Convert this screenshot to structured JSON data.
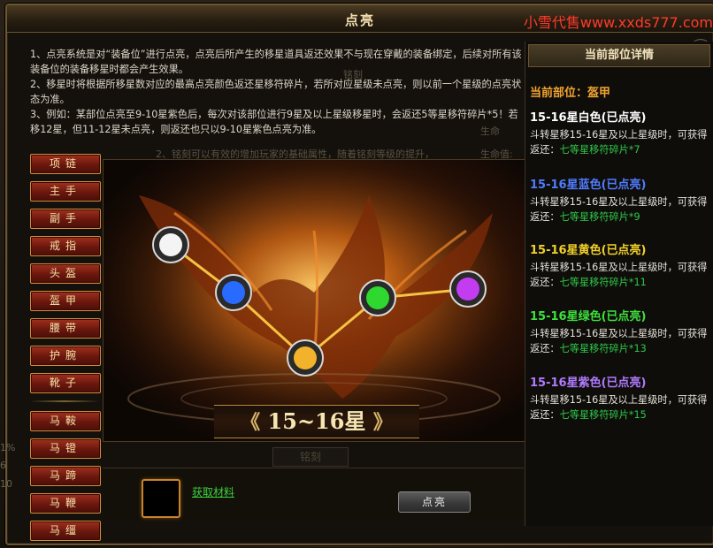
{
  "window": {
    "title": "点亮",
    "watermark": "小雪代售www.xxds777.com",
    "close": "✕"
  },
  "notes": [
    "1、点亮系统是对“装备位”进行点亮，点亮后所产生的移星道具返还效果不与现在穿戴的装备绑定，后续对所有该装备位的装备移星时都会产生效果。",
    "2、移星时将根据所移星数对应的最高点亮颜色返还星移符碎片，若所对应星级未点亮，则以前一个星级的点亮状态为准。",
    "3、例如：某部位点亮至9-10星紫色后，每次对该部位进行9星及以上星级移星时，会返还5等星移符碎片*5！若移12星，但11-12星未点亮，则返还也只以9-10星紫色点亮为准。"
  ],
  "ghosts": {
    "tab_top": "铭刻",
    "hint": "2、铭刻可以有效的增加玩家的基础属性，随着铭刻等级的提升，",
    "life": "生命值:",
    "gen": "生命",
    "tab_bottom": "铭刻"
  },
  "slots": [
    "项链",
    "主手",
    "副手",
    "戒指",
    "头盔",
    "盔甲",
    "腰带",
    "护腕",
    "靴子"
  ],
  "mount_slots": [
    "马鞍",
    "马镫",
    "马蹄",
    "马鞭",
    "马缰"
  ],
  "banner": {
    "text": "15~16星",
    "left": "《",
    "right": "》"
  },
  "orbs": [
    {
      "name": "white",
      "color": "#f4f4f4"
    },
    {
      "name": "blue",
      "color": "#2a6bff"
    },
    {
      "name": "yellow",
      "color": "#f2b22b"
    },
    {
      "name": "green",
      "color": "#2fd82f"
    },
    {
      "name": "purple",
      "color": "#c43cf0"
    }
  ],
  "materials": {
    "link": "获取材料"
  },
  "action": {
    "label": "点亮"
  },
  "right_panel": {
    "header": "当前部位详情",
    "current": "当前部位：盔甲",
    "tiers": [
      {
        "title": "15-16星白色(已点亮)",
        "color": "#ffffff",
        "desc": "斗转星移15-16星及以上星级时，可获得返还：",
        "reward": "七等星移符碎片*7"
      },
      {
        "title": "15-16星蓝色(已点亮)",
        "color": "#4f7cff",
        "desc": "斗转星移15-16星及以上星级时，可获得返还：",
        "reward": "七等星移符碎片*9"
      },
      {
        "title": "15-16星黄色(已点亮)",
        "color": "#f0d22a",
        "desc": "斗转星移15-16星及以上星级时，可获得返还：",
        "reward": "七等星移符碎片*11"
      },
      {
        "title": "15-16星绿色(已点亮)",
        "color": "#3de03d",
        "desc": "斗转星移15-16星及以上星级时，可获得返还：",
        "reward": "七等星移符碎片*13"
      },
      {
        "title": "15-16星紫色(已点亮)",
        "color": "#b07bff",
        "desc": "斗转星移15-16星及以上星级时，可获得返还：",
        "reward": "七等星移符碎片*15"
      }
    ]
  },
  "left_edge": [
    "1%",
    "6",
    "10"
  ]
}
